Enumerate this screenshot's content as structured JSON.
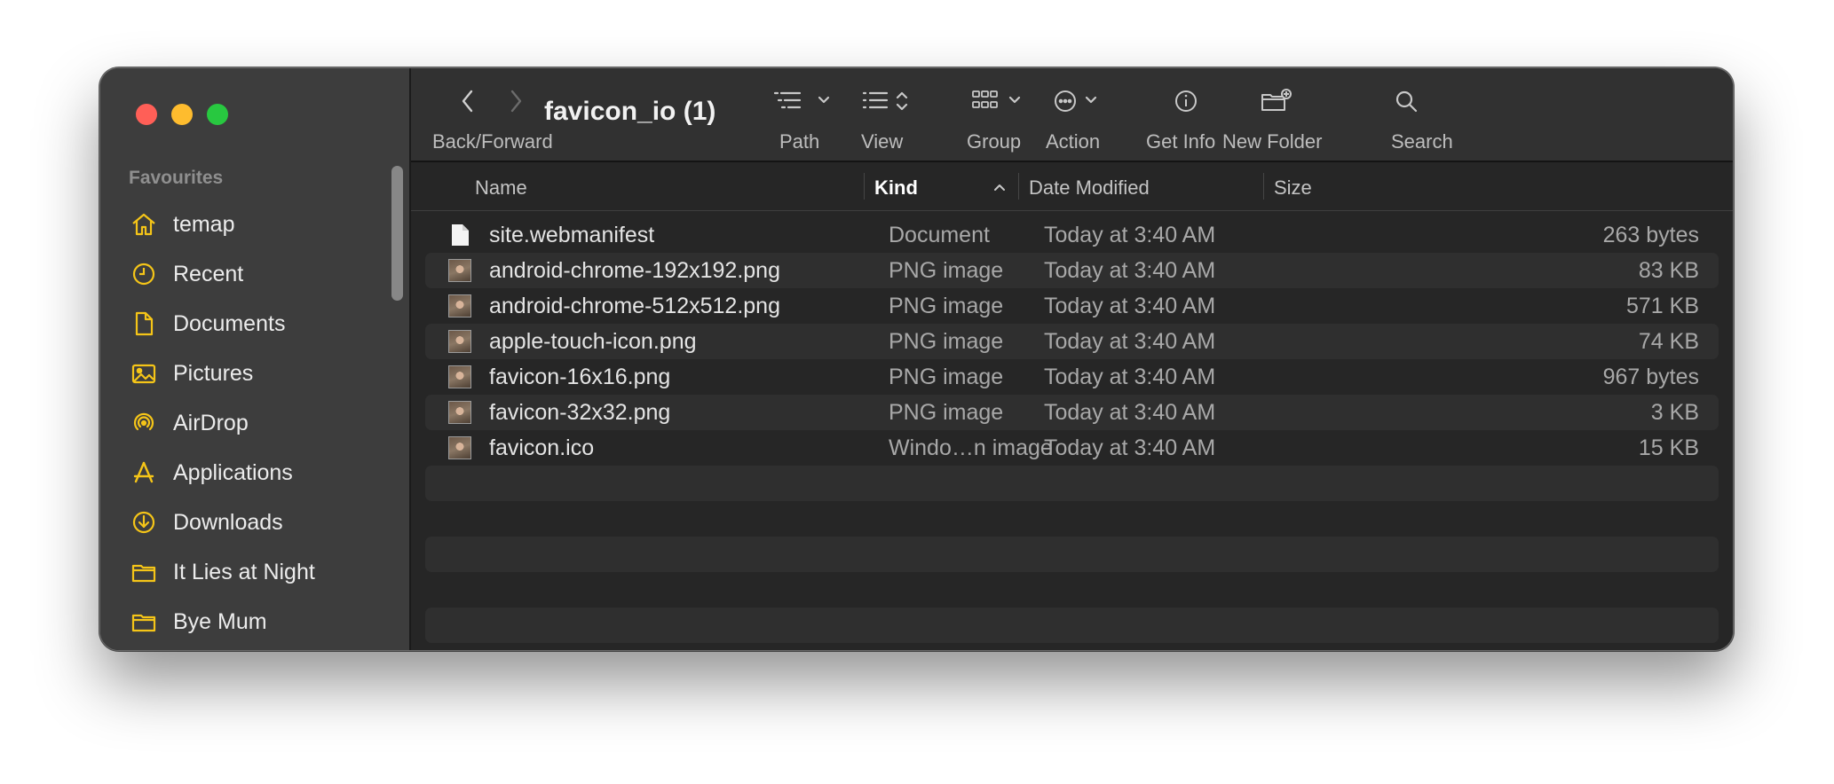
{
  "window": {
    "title": "favicon_io (1)"
  },
  "sidebar": {
    "section_title": "Favourites",
    "items": [
      {
        "label": "temap",
        "icon": "home-icon"
      },
      {
        "label": "Recent",
        "icon": "clock-icon"
      },
      {
        "label": "Documents",
        "icon": "document-icon"
      },
      {
        "label": "Pictures",
        "icon": "photo-icon"
      },
      {
        "label": "AirDrop",
        "icon": "airdrop-icon"
      },
      {
        "label": "Applications",
        "icon": "applications-icon"
      },
      {
        "label": "Downloads",
        "icon": "download-icon"
      },
      {
        "label": "It Lies at Night",
        "icon": "folder-icon"
      },
      {
        "label": "Bye Mum",
        "icon": "folder-icon"
      }
    ]
  },
  "toolbar": {
    "back_forward": "Back/Forward",
    "path": "Path",
    "view": "View",
    "group": "Group",
    "action": "Action",
    "get_info": "Get Info",
    "new_folder": "New Folder",
    "search": "Search"
  },
  "columns": {
    "name": "Name",
    "kind": "Kind",
    "date_modified": "Date Modified",
    "size": "Size"
  },
  "files": [
    {
      "name": "site.webmanifest",
      "kind": "Document",
      "date": "Today at 3:40 AM",
      "size": "263 bytes",
      "icon": "document-file-icon"
    },
    {
      "name": "android-chrome-192x192.png",
      "kind": "PNG image",
      "date": "Today at 3:40 AM",
      "size": "83 KB",
      "icon": "image-thumbnail-icon"
    },
    {
      "name": "android-chrome-512x512.png",
      "kind": "PNG image",
      "date": "Today at 3:40 AM",
      "size": "571 KB",
      "icon": "image-thumbnail-icon"
    },
    {
      "name": "apple-touch-icon.png",
      "kind": "PNG image",
      "date": "Today at 3:40 AM",
      "size": "74 KB",
      "icon": "image-thumbnail-icon"
    },
    {
      "name": "favicon-16x16.png",
      "kind": "PNG image",
      "date": "Today at 3:40 AM",
      "size": "967 bytes",
      "icon": "image-thumbnail-icon"
    },
    {
      "name": "favicon-32x32.png",
      "kind": "PNG image",
      "date": "Today at 3:40 AM",
      "size": "3 KB",
      "icon": "image-thumbnail-icon"
    },
    {
      "name": "favicon.ico",
      "kind": "Windo…n image",
      "date": "Today at 3:40 AM",
      "size": "15 KB",
      "icon": "image-thumbnail-icon"
    }
  ],
  "colors": {
    "accent_icon": "#f5c518",
    "close": "#ff5f57",
    "minimize": "#febc2e",
    "zoom": "#28c840"
  }
}
